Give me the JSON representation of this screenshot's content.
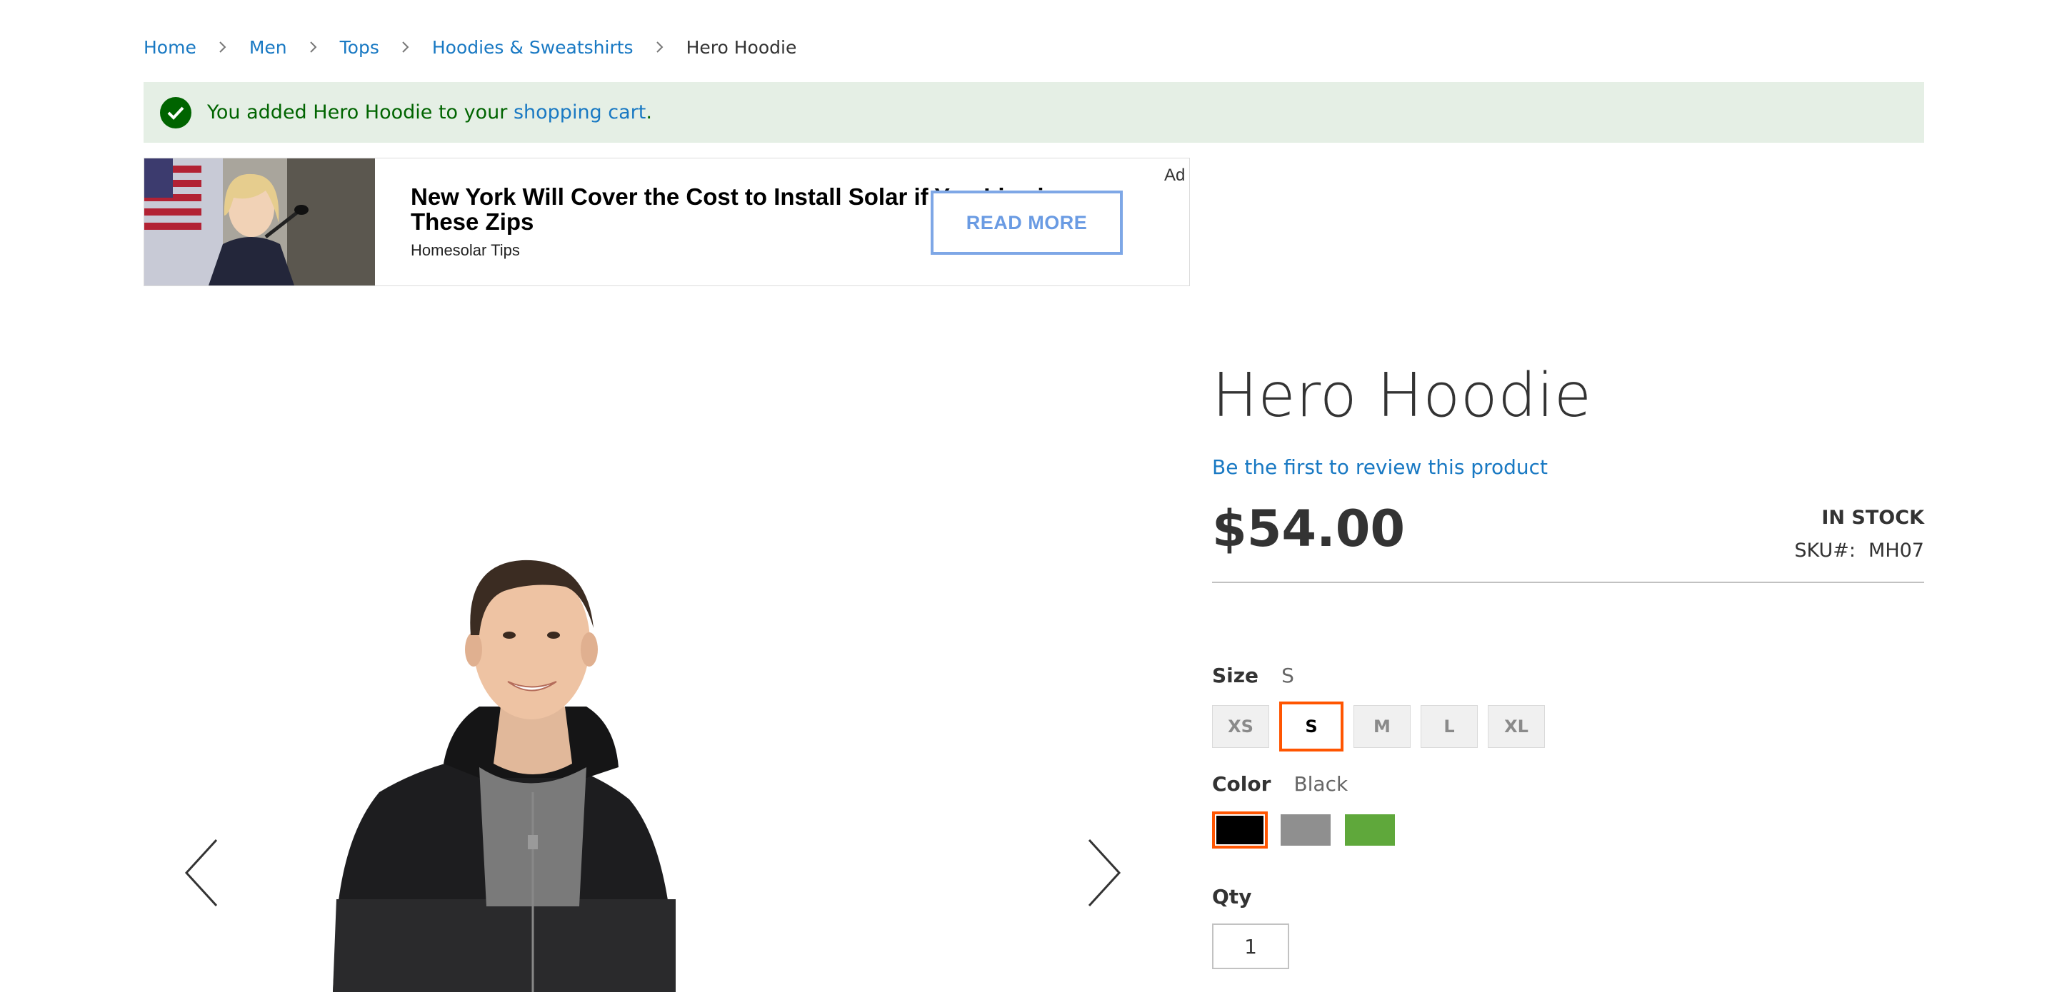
{
  "breadcrumbs": {
    "items": [
      {
        "label": "Home"
      },
      {
        "label": "Men"
      },
      {
        "label": "Tops"
      },
      {
        "label": "Hoodies & Sweatshirts"
      }
    ],
    "current": "Hero Hoodie"
  },
  "message": {
    "prefix": "You added Hero Hoodie to your ",
    "link": "shopping cart",
    "suffix": "."
  },
  "ad": {
    "headline": "New York Will Cover the Cost to Install Solar if You Live in These Zips",
    "source": "Homesolar Tips",
    "cta": "READ MORE",
    "label": "Ad"
  },
  "product": {
    "title": "Hero Hoodie",
    "review_link": "Be the first to review this product",
    "price": "$54.00",
    "stock": "IN STOCK",
    "sku_label": "SKU#:",
    "sku_value": "MH07"
  },
  "options": {
    "size": {
      "label": "Size",
      "selected": "S",
      "values": [
        "XS",
        "S",
        "M",
        "L",
        "XL"
      ]
    },
    "color": {
      "label": "Color",
      "selected": "Black",
      "swatches": [
        {
          "name": "Black",
          "hex": "#000000"
        },
        {
          "name": "Gray",
          "hex": "#8f8f8f"
        },
        {
          "name": "Green",
          "hex": "#5fa83b"
        }
      ]
    }
  },
  "qty": {
    "label": "Qty",
    "value": "1"
  },
  "colors": {
    "link": "#1979c3",
    "success_bg": "#e5efe5",
    "success_text": "#006400",
    "selected_border": "#ff5501"
  }
}
